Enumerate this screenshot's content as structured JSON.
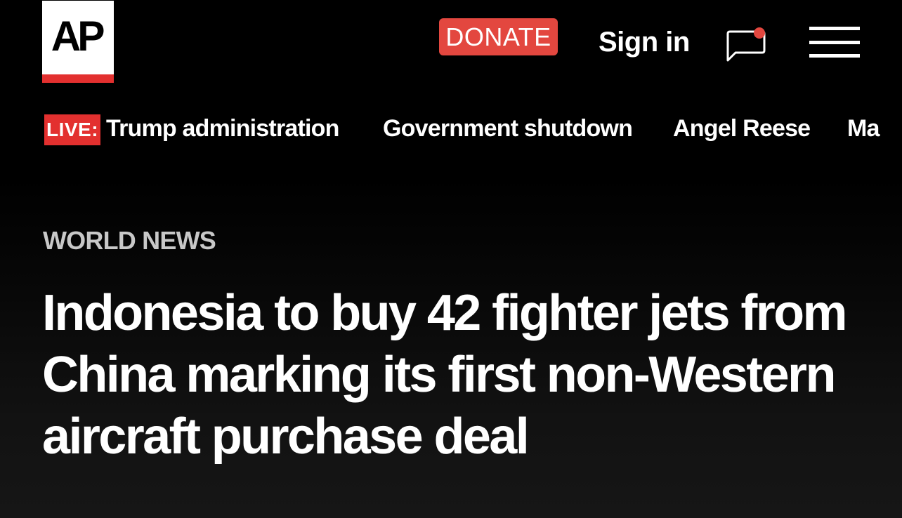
{
  "header": {
    "logo_text": "AP",
    "donate_label": "DONATE",
    "signin_label": "Sign in",
    "chat_icon": "chat-bubble-icon",
    "menu_icon": "hamburger-menu-icon"
  },
  "trending": {
    "live_label": "LIVE:",
    "items": [
      "Trump administration",
      "Government shutdown",
      "Angel Reese",
      "Ma"
    ]
  },
  "article": {
    "section": "WORLD NEWS",
    "headline": "Indonesia to buy 42 fighter jets from China marking its first non-Western aircraft purchase deal"
  },
  "colors": {
    "background": "#000000",
    "accent_red": "#e3302f",
    "donate_bg": "#e3473f",
    "section_text": "#c8c8c8",
    "text": "#ffffff"
  }
}
